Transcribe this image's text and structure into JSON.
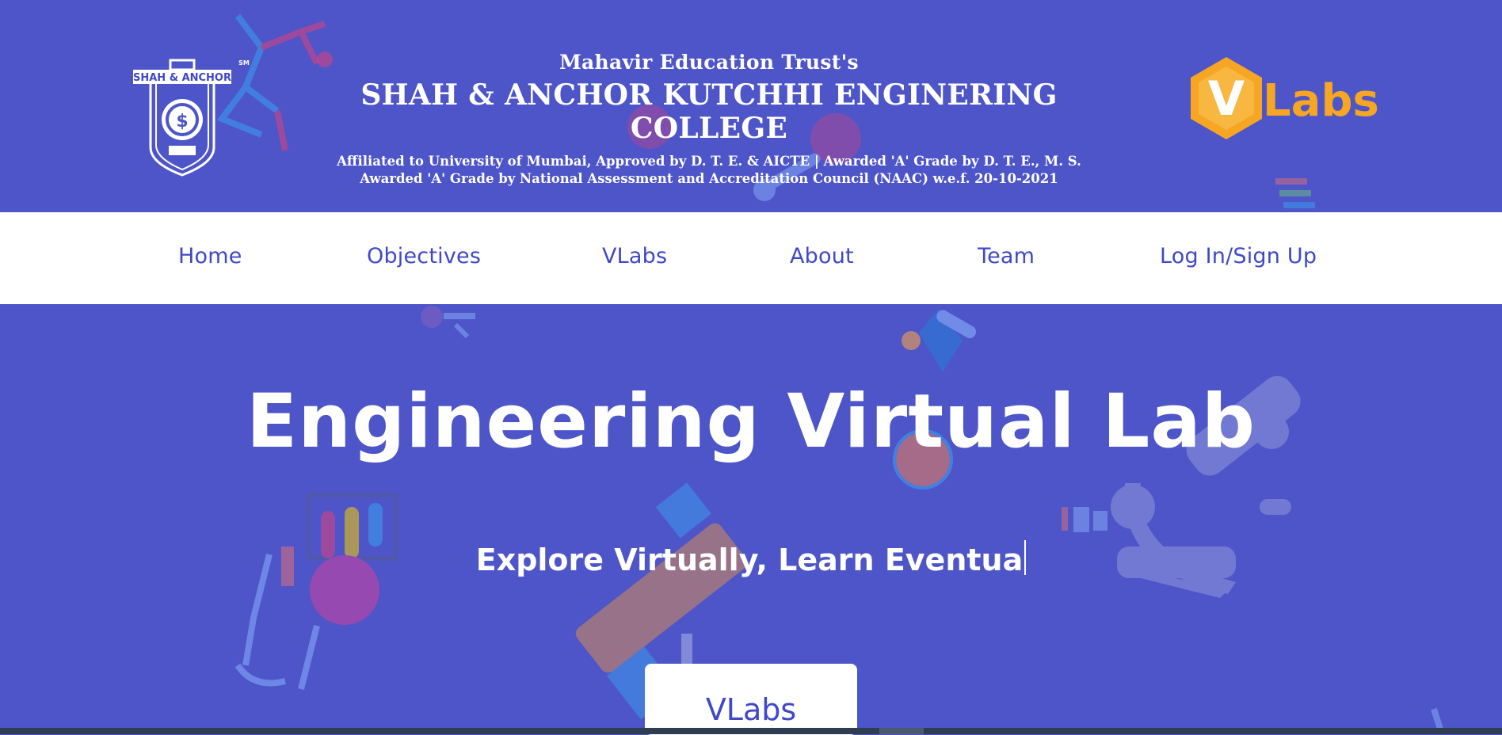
{
  "header": {
    "logo_text": "SHAH & ANCHOR",
    "logo_mark": "SM",
    "trust": "Mahavir Education Trust's",
    "college_name": "SHAH & ANCHOR KUTCHHI ENGINERING COLLEGE",
    "affiliation_line1": "Affiliated to University of Mumbai, Approved by D. T. E. & AICTE | Awarded 'A' Grade by D. T. E., M. S.",
    "affiliation_line2": "Awarded 'A' Grade by National Assessment and Accreditation Council (NAAC) w.e.f. 20-10-2021",
    "vlabs_logo_text": "Labs",
    "vlabs_logo_letter": "V"
  },
  "nav": {
    "items": [
      {
        "label": "Home"
      },
      {
        "label": "Objectives"
      },
      {
        "label": "VLabs"
      },
      {
        "label": "About"
      },
      {
        "label": "Team"
      },
      {
        "label": "Log In/Sign Up"
      }
    ]
  },
  "hero": {
    "title": "Engineering Virtual Lab",
    "subtitle": "Explore Virtually, Learn Eventua",
    "button_label": "VLabs"
  },
  "colors": {
    "background": "#4d55c8",
    "nav_background": "#ffffff",
    "nav_text": "#3f48c7",
    "vlabs_orange": "#f6a623"
  }
}
